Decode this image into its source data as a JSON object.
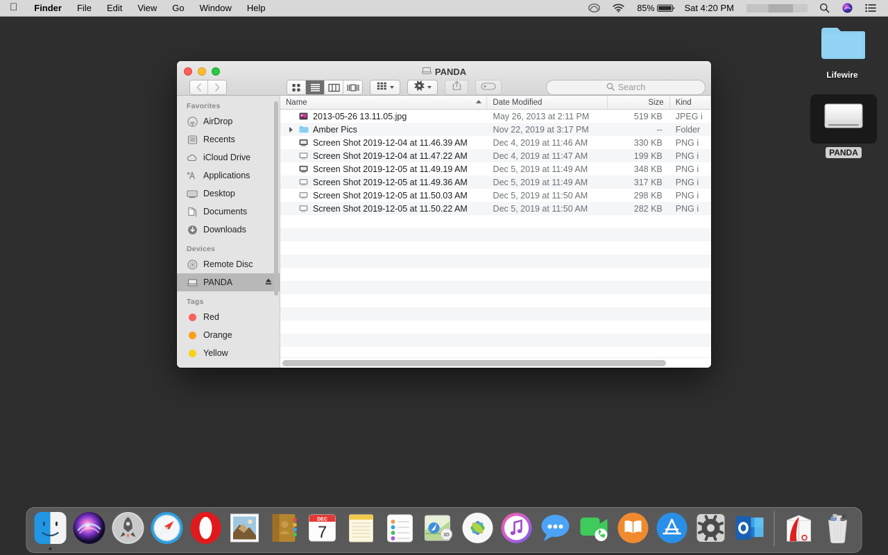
{
  "menubar": {
    "apple_icon": "apple-logo-icon",
    "items": [
      {
        "label": "Finder",
        "bold": true
      },
      {
        "label": "File",
        "bold": false
      },
      {
        "label": "Edit",
        "bold": false
      },
      {
        "label": "View",
        "bold": false
      },
      {
        "label": "Go",
        "bold": false
      },
      {
        "label": "Window",
        "bold": false
      },
      {
        "label": "Help",
        "bold": false
      }
    ],
    "status": {
      "creative_cloud_icon": "creative-cloud-icon",
      "wifi_icon": "wifi-icon",
      "battery_percent": "85%",
      "battery_icon": "battery-icon",
      "clock": "Sat 4:20 PM",
      "spotlight_icon": "search-icon",
      "siri_icon": "siri-icon",
      "control_center_icon": "list-menu-icon"
    }
  },
  "desktop": {
    "icons": [
      {
        "name": "Lifewire",
        "type": "folder",
        "selected": false
      },
      {
        "name": "PANDA",
        "type": "drive",
        "selected": true
      }
    ]
  },
  "finder": {
    "title": "PANDA",
    "title_icon": "hard-drive-icon",
    "window_controls": {
      "close": "close-button",
      "minimize": "minimize-button",
      "zoom": "zoom-button"
    },
    "toolbar": {
      "back_label": "Back",
      "forward_label": "Forward",
      "views": [
        {
          "name": "icon-view",
          "active": false
        },
        {
          "name": "list-view",
          "active": true
        },
        {
          "name": "column-view",
          "active": false
        },
        {
          "name": "gallery-view",
          "active": false
        }
      ],
      "arrange_label": "Arrange",
      "action_label": "Action",
      "share_label": "Share",
      "tags_label": "Edit Tags"
    },
    "search": {
      "placeholder": "Search",
      "value": ""
    },
    "sidebar": {
      "sections": [
        {
          "heading": "Favorites",
          "items": [
            {
              "label": "AirDrop",
              "icon": "airdrop-icon",
              "active": false
            },
            {
              "label": "Recents",
              "icon": "recents-clock-icon",
              "active": false
            },
            {
              "label": "iCloud Drive",
              "icon": "cloud-icon",
              "active": false
            },
            {
              "label": "Applications",
              "icon": "applications-icon",
              "active": false
            },
            {
              "label": "Desktop",
              "icon": "desktop-icon",
              "active": false
            },
            {
              "label": "Documents",
              "icon": "documents-icon",
              "active": false
            },
            {
              "label": "Downloads",
              "icon": "downloads-icon",
              "active": false
            }
          ]
        },
        {
          "heading": "Devices",
          "items": [
            {
              "label": "Remote Disc",
              "icon": "optical-disc-icon",
              "active": false
            },
            {
              "label": "PANDA",
              "icon": "hard-drive-icon",
              "active": true,
              "eject": true
            }
          ]
        },
        {
          "heading": "Tags",
          "items": [
            {
              "label": "Red",
              "icon": "tag-dot-icon",
              "color": "#f9615b",
              "active": false
            },
            {
              "label": "Orange",
              "icon": "tag-dot-icon",
              "color": "#f9a01b",
              "active": false
            },
            {
              "label": "Yellow",
              "icon": "tag-dot-icon",
              "color": "#f7d117",
              "active": false
            }
          ]
        }
      ]
    },
    "filelist": {
      "columns": [
        {
          "key": "name",
          "label": "Name",
          "sorted": true,
          "sort_dir": "asc"
        },
        {
          "key": "date",
          "label": "Date Modified"
        },
        {
          "key": "size",
          "label": "Size"
        },
        {
          "key": "kind",
          "label": "Kind"
        }
      ],
      "rows": [
        {
          "name": "2013-05-26 13.11.05.jpg",
          "date": "May 26, 2013 at 2:11 PM",
          "size": "519 KB",
          "kind": "JPEG i",
          "icon": "image-file-icon",
          "expandable": false
        },
        {
          "name": "Amber Pics",
          "date": "Nov 22, 2019 at 3:17 PM",
          "size": "--",
          "kind": "Folder",
          "icon": "folder-icon",
          "expandable": true
        },
        {
          "name": "Screen Shot 2019-12-04 at 11.46.39 AM",
          "date": "Dec 4, 2019 at 11:46 AM",
          "size": "330 KB",
          "kind": "PNG i",
          "icon": "screenshot-file-icon",
          "expandable": false
        },
        {
          "name": "Screen Shot 2019-12-04 at 11.47.22 AM",
          "date": "Dec 4, 2019 at 11:47 AM",
          "size": "199 KB",
          "kind": "PNG i",
          "icon": "screenshot-file-icon",
          "expandable": false
        },
        {
          "name": "Screen Shot 2019-12-05 at 11.49.19 AM",
          "date": "Dec 5, 2019 at 11:49 AM",
          "size": "348 KB",
          "kind": "PNG i",
          "icon": "screenshot-file-icon",
          "expandable": false
        },
        {
          "name": "Screen Shot 2019-12-05 at 11.49.36 AM",
          "date": "Dec 5, 2019 at 11:49 AM",
          "size": "317 KB",
          "kind": "PNG i",
          "icon": "screenshot-file-icon",
          "expandable": false
        },
        {
          "name": "Screen Shot 2019-12-05 at 11.50.03 AM",
          "date": "Dec 5, 2019 at 11:50 AM",
          "size": "298 KB",
          "kind": "PNG i",
          "icon": "screenshot-file-icon",
          "expandable": false
        },
        {
          "name": "Screen Shot 2019-12-05 at 11.50.22 AM",
          "date": "Dec 5, 2019 at 11:50 AM",
          "size": "282 KB",
          "kind": "PNG i",
          "icon": "screenshot-file-icon",
          "expandable": false
        }
      ]
    }
  },
  "dock": {
    "items": [
      {
        "name": "Finder",
        "icon": "finder-icon",
        "running": true
      },
      {
        "name": "Siri",
        "icon": "siri-icon",
        "running": false
      },
      {
        "name": "Launchpad",
        "icon": "launchpad-icon",
        "running": false
      },
      {
        "name": "Safari",
        "icon": "safari-icon",
        "running": false
      },
      {
        "name": "Opera",
        "icon": "opera-icon",
        "running": false
      },
      {
        "name": "Mail",
        "icon": "mail-stamp-icon",
        "running": false
      },
      {
        "name": "Contacts",
        "icon": "contacts-icon",
        "running": false
      },
      {
        "name": "Calendar",
        "icon": "calendar-icon",
        "running": false,
        "month": "DEC",
        "day": "7"
      },
      {
        "name": "Notes",
        "icon": "notes-icon",
        "running": false
      },
      {
        "name": "Reminders",
        "icon": "reminders-icon",
        "running": false
      },
      {
        "name": "Maps",
        "icon": "maps-icon",
        "running": false
      },
      {
        "name": "Photos",
        "icon": "photos-icon",
        "running": false
      },
      {
        "name": "iTunes",
        "icon": "itunes-icon",
        "running": false
      },
      {
        "name": "Messages",
        "icon": "messages-icon",
        "running": false
      },
      {
        "name": "FaceTime",
        "icon": "facetime-icon",
        "running": false
      },
      {
        "name": "Books",
        "icon": "books-icon",
        "running": false
      },
      {
        "name": "App Store",
        "icon": "app-store-icon",
        "running": false
      },
      {
        "name": "System Preferences",
        "icon": "system-preferences-icon",
        "running": false
      },
      {
        "name": "Outlook",
        "icon": "outlook-icon",
        "running": false
      }
    ],
    "right_items": [
      {
        "name": "Downloads",
        "icon": "downloads-stack-icon"
      },
      {
        "name": "Trash",
        "icon": "trash-icon"
      }
    ]
  }
}
